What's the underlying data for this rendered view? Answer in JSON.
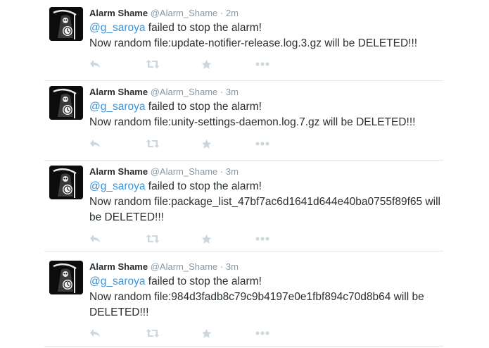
{
  "tweets": [
    {
      "name": "Alarm Shame",
      "handle": "@Alarm_Shame",
      "sep": "·",
      "time": "2m",
      "mention": "@g_saroya",
      "line1": " failed to stop the alarm!",
      "line2": "Now random file:update-notifier-release.log.3.gz will be DELETED!!!"
    },
    {
      "name": "Alarm Shame",
      "handle": "@Alarm_Shame",
      "sep": "·",
      "time": "3m",
      "mention": "@g_saroya",
      "line1": " failed to stop the alarm!",
      "line2": "Now random file:unity-settings-daemon.log.7.gz will be DELETED!!!"
    },
    {
      "name": "Alarm Shame",
      "handle": "@Alarm_Shame",
      "sep": "·",
      "time": "3m",
      "mention": "@g_saroya",
      "line1": " failed to stop the alarm!",
      "line2": "Now random file:package_list_47bf7ac6d1641d644e40ba0755f89f65 will be DELETED!!!"
    },
    {
      "name": "Alarm Shame",
      "handle": "@Alarm_Shame",
      "sep": "·",
      "time": "3m",
      "mention": "@g_saroya",
      "line1": " failed to stop the alarm!",
      "line2": "Now random file:984d3fadb8c79c9b4197e0e1fbf894c70d8b64 will be DELETED!!!"
    }
  ],
  "action_icons": [
    "reply-icon",
    "retweet-icon",
    "favorite-star-icon",
    "more-dots-icon"
  ],
  "colors": {
    "text": "#292f33",
    "secondary": "#8899a6",
    "mention": "#3b94d9",
    "icon": "#ccd6dd",
    "divider": "#e1e8ed"
  }
}
